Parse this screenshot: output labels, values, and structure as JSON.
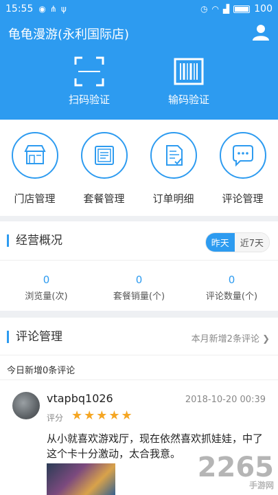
{
  "status_bar": {
    "time": "15:55",
    "battery": "100",
    "icons": [
      "moments-icon",
      "share-icon",
      "usb-icon",
      "alarm-icon",
      "wifi-icon",
      "signal-icon",
      "battery-icon"
    ]
  },
  "header": {
    "store_name": "龟龟漫游(永利国际店)",
    "scan_label": "扫码验证",
    "input_code_label": "输码验证"
  },
  "menu": {
    "items": [
      {
        "label": "门店管理",
        "icon": "store-icon"
      },
      {
        "label": "套餐管理",
        "icon": "package-icon"
      },
      {
        "label": "订单明细",
        "icon": "order-icon"
      },
      {
        "label": "评论管理",
        "icon": "comment-icon"
      }
    ]
  },
  "overview": {
    "title": "经营概况",
    "toggle": {
      "active": "昨天",
      "inactive": "近7天"
    },
    "stats": [
      {
        "value": "0",
        "label": "浏览量(次)"
      },
      {
        "value": "0",
        "label": "套餐销量(个)"
      },
      {
        "value": "0",
        "label": "评论数量(个)"
      }
    ]
  },
  "reviews": {
    "title": "评论管理",
    "month_new": "本月新增2条评论",
    "today_new": "今日新增0条评论",
    "item": {
      "username": "vtapbq1026",
      "time": "2018-10-20 00:39",
      "rating_label": "评分",
      "stars": "★★★★★",
      "text": "从小就喜欢游戏厅，现在依然喜欢抓娃娃，中了这个卡十分激动，太合我意。"
    }
  },
  "watermark": {
    "brand": "2265",
    "sub": "手游网"
  },
  "colors": {
    "accent": "#2d9bf0",
    "star": "#f5a623"
  }
}
